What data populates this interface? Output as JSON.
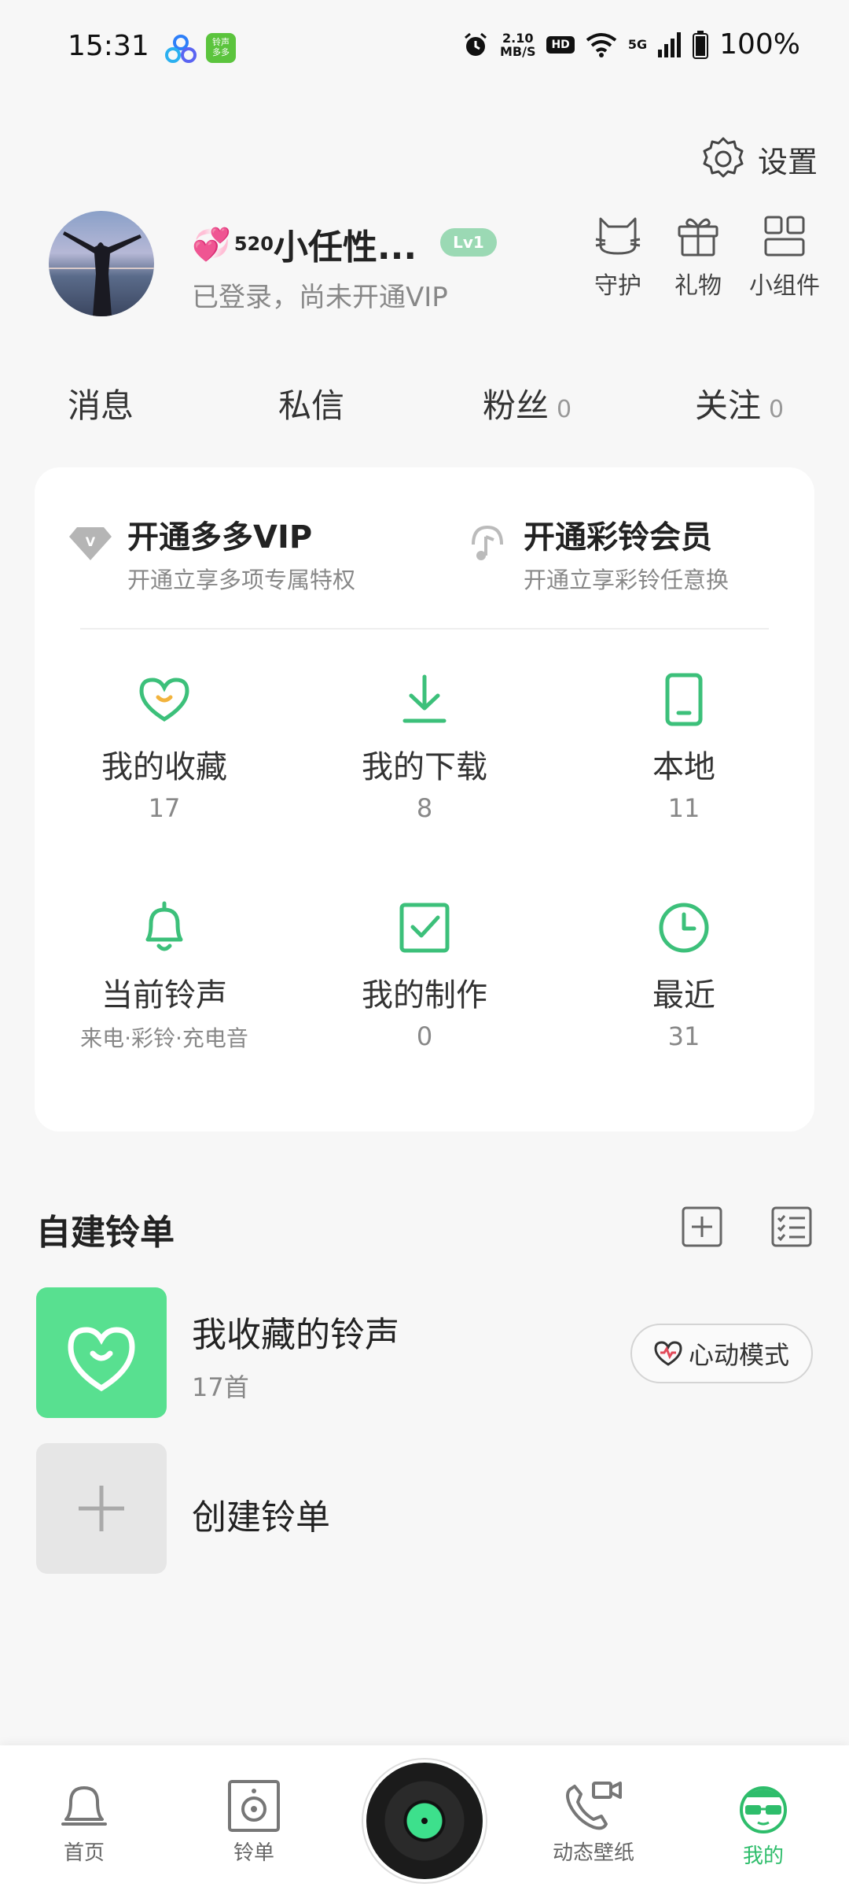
{
  "status_bar": {
    "time": "15:31",
    "speed_top": "2.10",
    "speed_bottom": "MB/S",
    "hd": "HD",
    "network": "5G",
    "battery": "100%"
  },
  "header": {
    "settings_label": "设置"
  },
  "profile": {
    "name_emoji": "💞",
    "name_sub": "5",
    "name_sup": "20",
    "name_text": "小任性...",
    "level_badge": "Lv1",
    "status": "已登录，尚未开通VIP"
  },
  "quick_actions": [
    {
      "label": "守护",
      "icon": "cat-icon"
    },
    {
      "label": "礼物",
      "icon": "gift-icon"
    },
    {
      "label": "小组件",
      "icon": "widget-icon"
    }
  ],
  "social": {
    "messages": "消息",
    "private": "私信",
    "fans_label": "粉丝",
    "fans_count": "0",
    "follow_label": "关注",
    "follow_count": "0"
  },
  "vip": {
    "vip_title": "开通多多VIP",
    "vip_sub": "开通立享多项专属特权",
    "ring_title": "开通彩铃会员",
    "ring_sub": "开通立享彩铃任意换"
  },
  "grid": [
    {
      "label": "我的收藏",
      "value": "17",
      "icon": "heart-icon"
    },
    {
      "label": "我的下载",
      "value": "8",
      "icon": "download-icon"
    },
    {
      "label": "本地",
      "value": "11",
      "icon": "phone-icon"
    },
    {
      "label": "当前铃声",
      "value": "来电·彩铃·充电音",
      "icon": "bell-icon"
    },
    {
      "label": "我的制作",
      "value": "0",
      "icon": "checkbox-icon"
    },
    {
      "label": "最近",
      "value": "31",
      "icon": "clock-icon"
    }
  ],
  "playlists": {
    "section_title": "自建铃单",
    "favorite_name": "我收藏的铃声",
    "favorite_count": "17首",
    "mode_label": "心动模式",
    "create_label": "创建铃单"
  },
  "bottom_nav": {
    "home": "首页",
    "playlist": "铃单",
    "wallpaper": "动态壁纸",
    "mine": "我的"
  },
  "colors": {
    "accent": "#2ebd6b",
    "cover": "#58e090"
  }
}
